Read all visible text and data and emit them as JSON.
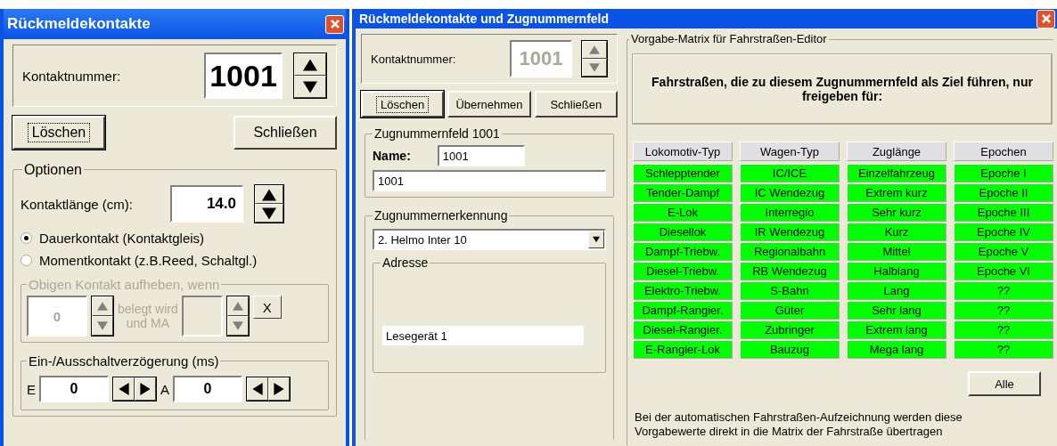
{
  "left_window": {
    "title": "Rückmeldekontakte",
    "contact_number": {
      "label": "Kontaktnummer:",
      "value": "1001"
    },
    "buttons": [
      {
        "label": "Löschen",
        "focused": true
      },
      {
        "label": "Schließen",
        "focused": false
      }
    ],
    "options": {
      "title": "Optionen",
      "length": {
        "label": "Kontaktlänge (cm):",
        "value": "14.0"
      },
      "radios": [
        {
          "label": "Dauerkontakt (Kontaktgleis)",
          "selected": true
        },
        {
          "label": "Momentkontakt (z.B.Reed, Schaltgl.)",
          "selected": false
        }
      ],
      "release": {
        "title": "Obigen Kontakt aufheben, wenn",
        "disabled": true,
        "value": "0",
        "text_1": "belegt wird",
        "text_2": "und MA",
        "clear": "X"
      },
      "delay": {
        "title": "Ein-/Ausschaltverzögerung (ms)",
        "fields": [
          {
            "label": "E",
            "value": "0"
          },
          {
            "label": "A",
            "value": "0"
          }
        ]
      }
    }
  },
  "right_window": {
    "title": "Rückmeldekontakte und Zugnummernfeld",
    "contact_number": {
      "label": "Kontaktnummer:",
      "value": "1001",
      "disabled": true
    },
    "buttons": [
      {
        "label": "Löschen",
        "focused": true
      },
      {
        "label": "Übernehmen",
        "focused": false
      },
      {
        "label": "Schließen",
        "focused": false
      }
    ],
    "field_group": {
      "title": "Zugnummernfeld 1001",
      "name_label": "Name:",
      "name_value": "1001",
      "text_value": "1001"
    },
    "recognition": {
      "title": "Zugnummernerkennung",
      "dropdown": "2. Helmo Inter 10",
      "address": {
        "title": "Adresse",
        "value": "Lesegerät 1"
      }
    },
    "matrix": {
      "title": "Vorgabe-Matrix für Fahrstraßen-Editor",
      "heading": "Fahrstraßen, die zu diesem Zugnummernfeld als Ziel führen, nur freigeben für:",
      "columns": [
        {
          "header": "Lokomotiv-Typ",
          "items": [
            {
              "label": "Schlepptender",
              "on": true
            },
            {
              "label": "Tender-Dampf",
              "on": true
            },
            {
              "label": "E-Lok",
              "on": true
            },
            {
              "label": "Diesellok",
              "on": true
            },
            {
              "label": "Dampf-Triebw.",
              "on": true
            },
            {
              "label": "Diesel-Triebw.",
              "on": true
            },
            {
              "label": "Elektro-Triebw.",
              "on": true
            },
            {
              "label": "Dampf-Rangier.",
              "on": true
            },
            {
              "label": "Diesel-Rangier.",
              "on": true
            },
            {
              "label": "E-Rangier-Lok",
              "on": true
            }
          ]
        },
        {
          "header": "Wagen-Typ",
          "items": [
            {
              "label": "IC/ICE",
              "on": true
            },
            {
              "label": "IC Wendezug",
              "on": true
            },
            {
              "label": "Interregio",
              "on": true
            },
            {
              "label": "IR Wendezug",
              "on": true
            },
            {
              "label": "Regionalbahn",
              "on": true
            },
            {
              "label": "RB Wendezug",
              "on": true
            },
            {
              "label": "S-Bahn",
              "on": true
            },
            {
              "label": "Güter",
              "on": true
            },
            {
              "label": "Zubringer",
              "on": true
            },
            {
              "label": "Bauzug",
              "on": true
            }
          ]
        },
        {
          "header": "Zuglänge",
          "items": [
            {
              "label": "Einzelfahrzeug",
              "on": true
            },
            {
              "label": "Extrem kurz",
              "on": true
            },
            {
              "label": "Sehr kurz",
              "on": true
            },
            {
              "label": "Kurz",
              "on": true
            },
            {
              "label": "Mittel",
              "on": true
            },
            {
              "label": "Halblang",
              "on": true
            },
            {
              "label": "Lang",
              "on": true
            },
            {
              "label": "Sehr lang",
              "on": true
            },
            {
              "label": "Extrem lang",
              "on": true
            },
            {
              "label": "Mega lang",
              "on": true
            }
          ]
        },
        {
          "header": "Epochen",
          "items": [
            {
              "label": "Epoche I",
              "on": true
            },
            {
              "label": "Epoche II",
              "on": true
            },
            {
              "label": "Epoche III",
              "on": true
            },
            {
              "label": "Epoche IV",
              "on": true
            },
            {
              "label": "Epoche V",
              "on": true
            },
            {
              "label": "Epoche VI",
              "on": true
            },
            {
              "label": "??",
              "on": true
            },
            {
              "label": "??",
              "on": true
            },
            {
              "label": "??",
              "on": true
            },
            {
              "label": "??",
              "on": true
            }
          ]
        }
      ],
      "all_button": "Alle",
      "note": "Bei der automatischen Fahrstraßen-Aufzeichnung werden diese Vorgabewerte direkt in die Matrix der Fahrstraße übertragen"
    }
  }
}
